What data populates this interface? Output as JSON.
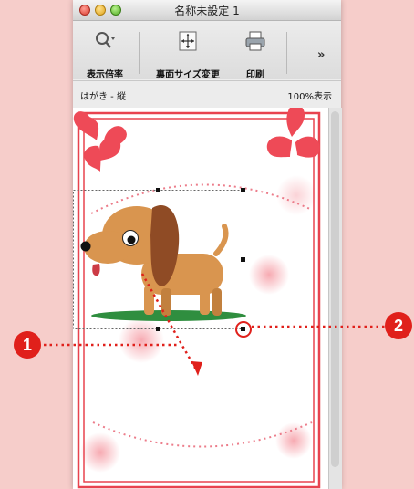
{
  "window": {
    "title": "名称未設定 1"
  },
  "toolbar": {
    "zoom_label": "表示倍率",
    "flip_label": "裏面サイズ変更",
    "print_label": "印刷",
    "more_label": "»"
  },
  "status": {
    "paper": "はがき - 縦",
    "zoom": "100%表示"
  },
  "callouts": [
    {
      "label": "1",
      "color": "#e0201b"
    },
    {
      "label": "2",
      "color": "#e0201b"
    }
  ],
  "colors": {
    "border_red": "#e8434f",
    "callout_red": "#e0201b",
    "heart_red": "#ee4a57",
    "dog_body": "#d9954f",
    "dog_ear": "#8f4b25",
    "grass": "#2f8e3f"
  }
}
